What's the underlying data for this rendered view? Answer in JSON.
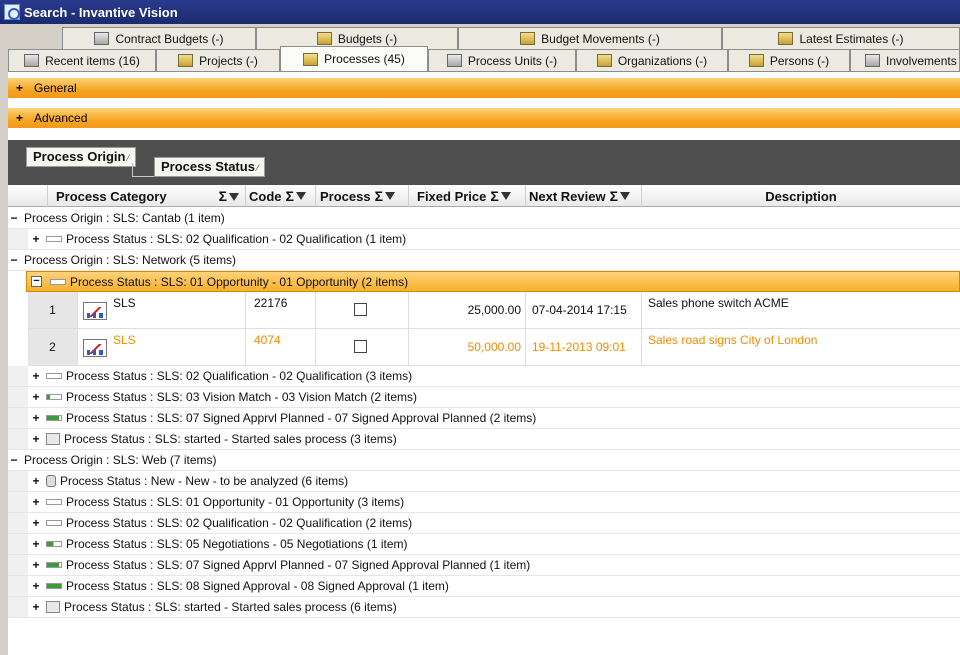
{
  "window": {
    "title": "Search - Invantive Vision"
  },
  "tabs_top": [
    {
      "label": "Contract Budgets (-)",
      "icon": "contract-budgets-icon"
    },
    {
      "label": "Budgets (-)",
      "icon": "budgets-icon"
    },
    {
      "label": "Budget Movements (-)",
      "icon": "budget-movements-icon"
    },
    {
      "label": "Latest Estimates (-)",
      "icon": "latest-estimates-icon"
    }
  ],
  "tabs_bottom": [
    {
      "label": "Recent items (16)",
      "icon": "recent-items-icon"
    },
    {
      "label": "Projects (-)",
      "icon": "projects-icon"
    },
    {
      "label": "Processes (45)",
      "icon": "processes-icon",
      "active": true
    },
    {
      "label": "Process Units (-)",
      "icon": "process-units-icon"
    },
    {
      "label": "Organizations (-)",
      "icon": "organizations-icon"
    },
    {
      "label": "Persons (-)",
      "icon": "persons-icon"
    },
    {
      "label": "Involvements",
      "icon": "involvements-icon"
    }
  ],
  "panels": {
    "general": {
      "toggle": "+",
      "label": "General"
    },
    "advanced": {
      "toggle": "+",
      "label": "Advanced"
    }
  },
  "groupby": {
    "chips": [
      {
        "label": "Process Origin",
        "sort": "⁄"
      },
      {
        "label": "Process Status",
        "sort": "⁄"
      }
    ]
  },
  "columns": {
    "category": "Process Category",
    "code": "Code",
    "process": "Process",
    "fixed_price": "Fixed Price",
    "next_review": "Next Review",
    "description": "Description",
    "sigma": "Σ"
  },
  "groups": [
    {
      "toggle": "−",
      "label": "Process Origin : SLS: Cantab (1 item)",
      "statuses": [
        {
          "toggle": "+",
          "icon": "status-empty",
          "label": "Process Status : SLS: 02 Qualification - 02 Qualification (1 item)"
        }
      ]
    },
    {
      "toggle": "−",
      "label": "Process Origin : SLS: Network (5 items)",
      "statuses": [
        {
          "toggle": "−",
          "icon": "status-empty",
          "label": "Process Status : SLS: 01 Opportunity - 01 Opportunity (2 items)",
          "selected": true
        },
        {
          "toggle": "+",
          "icon": "status-empty",
          "label": "Process Status : SLS: 02 Qualification - 02 Qualification (3 items)"
        },
        {
          "toggle": "+",
          "icon": "status-one",
          "label": "Process Status : SLS: 03 Vision Match - 03 Vision Match (2 items)"
        },
        {
          "toggle": "+",
          "icon": "status-four",
          "label": "Process Status : SLS: 07 Signed Apprvl Planned - 07 Signed Approval Planned (2 items)"
        },
        {
          "toggle": "+",
          "icon": "status-doc",
          "label": "Process Status : SLS: started - Started sales process (3 items)"
        }
      ]
    },
    {
      "toggle": "−",
      "label": "Process Origin : SLS: Web (7 items)",
      "statuses": [
        {
          "toggle": "+",
          "icon": "status-new",
          "label": "Process Status : New - New - to be analyzed (6 items)"
        },
        {
          "toggle": "+",
          "icon": "status-empty",
          "label": "Process Status : SLS: 01 Opportunity - 01 Opportunity (3 items)"
        },
        {
          "toggle": "+",
          "icon": "status-empty",
          "label": "Process Status : SLS: 02 Qualification - 02 Qualification (2 items)"
        },
        {
          "toggle": "+",
          "icon": "status-two",
          "label": "Process Status : SLS: 05 Negotiations - 05 Negotiations (1 item)"
        },
        {
          "toggle": "+",
          "icon": "status-four",
          "label": "Process Status : SLS: 07 Signed Apprvl Planned - 07 Signed Approval Planned (1 item)"
        },
        {
          "toggle": "+",
          "icon": "status-full",
          "label": "Process Status : SLS: 08 Signed Approval - 08 Signed Approval (1 item)"
        },
        {
          "toggle": "+",
          "icon": "status-doc",
          "label": "Process Status : SLS: started - Started sales process (6 items)"
        }
      ]
    }
  ],
  "rows": [
    {
      "num": "1",
      "category": "SLS",
      "code": "22176",
      "price": "25,000.00",
      "review": "07-04-2014 17:15",
      "description": "Sales phone switch ACME",
      "highlight": false
    },
    {
      "num": "2",
      "category": "SLS",
      "code": "4074",
      "price": "50,000.00",
      "review": "19-11-2013 09:01",
      "description": "Sales road signs City of London",
      "highlight": true
    }
  ],
  "colors": {
    "accent": "#f6a623",
    "title_bar": "#1c2a6e",
    "highlight_text": "#f08c00"
  }
}
